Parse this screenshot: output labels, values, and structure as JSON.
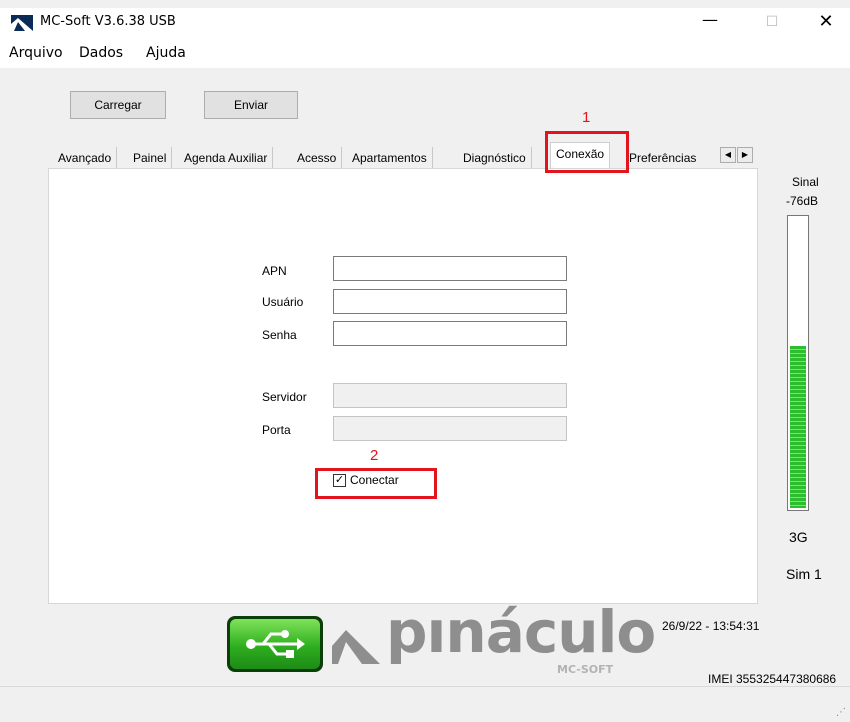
{
  "window": {
    "title": "MC-Soft V3.6.38 USB",
    "minimize_glyph": "—",
    "maximize_glyph": "☐",
    "close_glyph": "✕",
    "icon": "pinaculo-app-icon"
  },
  "menu": {
    "items": [
      "Arquivo",
      "Dados",
      "Ajuda"
    ]
  },
  "toolbar": {
    "load_label": "Carregar",
    "send_label": "Enviar"
  },
  "tabs": {
    "items": [
      "Avançado",
      "Painel",
      "Agenda Auxiliar",
      "Acesso",
      "Apartamentos",
      "Diagnóstico",
      "Conexão",
      "Preferências"
    ],
    "active": "Conexão",
    "scroll_left": "◀",
    "scroll_right": "▶"
  },
  "connection": {
    "apn_label": "APN",
    "user_label": "Usuário",
    "password_label": "Senha",
    "server_label": "Servidor",
    "port_label": "Porta",
    "apn_value": "",
    "user_value": "",
    "password_value": "",
    "server_value": "",
    "port_value": "",
    "connect_label": "Conectar",
    "connect_checked": true,
    "check_glyph": "✓"
  },
  "signal": {
    "label": "Sinal",
    "db": "-76dB",
    "level_fraction": 0.55,
    "network": "3G",
    "sim": "Sim 1"
  },
  "status": {
    "datetime": "26/9/22 - 13:54:31",
    "imei": "IMEI 355325447380686"
  },
  "logo": {
    "name": "pınáculo",
    "sub": "MC-SOFT",
    "usb_icon": "usb-icon"
  },
  "annotations": [
    "1",
    "2"
  ],
  "colors": {
    "annotation": "#e3141b",
    "signal_green": "#2ebd2e",
    "usb_green": "#2fae1f"
  }
}
